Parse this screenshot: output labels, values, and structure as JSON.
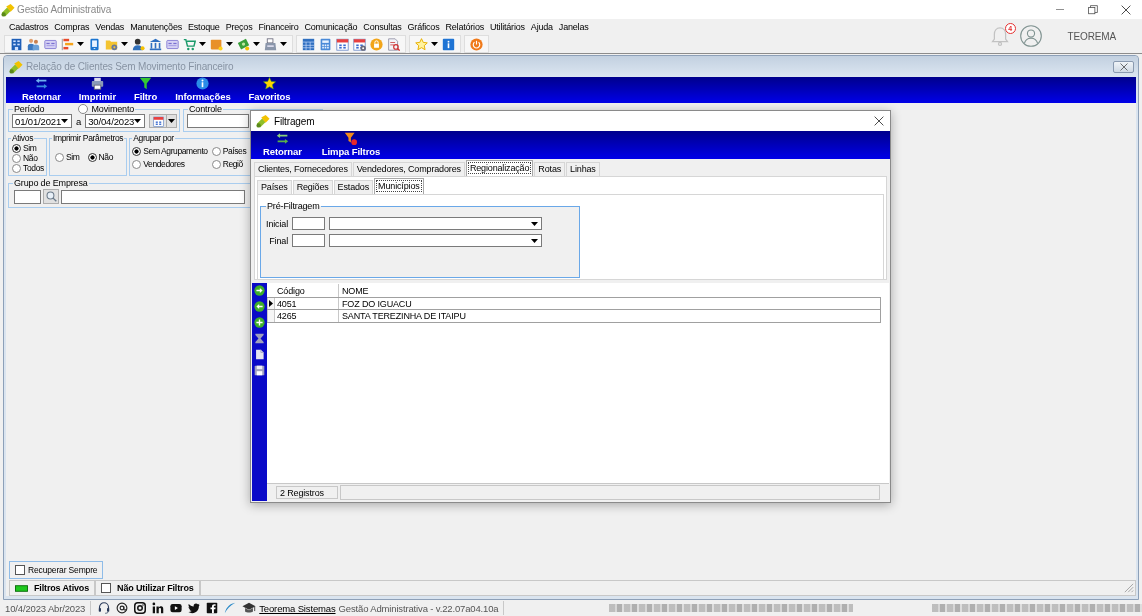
{
  "window": {
    "title": "Gestão Administrativa"
  },
  "menu": [
    "Cadastros",
    "Compras",
    "Vendas",
    "Manutenções",
    "Estoque",
    "Preços",
    "Financeiro",
    "Comunicação",
    "Consultas",
    "Gráficos",
    "Relatórios",
    "Utilitários",
    "Ajuda",
    "Janelas"
  ],
  "notifications": {
    "count": "4"
  },
  "user": {
    "name": "TEOREMA"
  },
  "report_window": {
    "title": "Relação de Clientes Sem Movimento Financeiro",
    "toolbar": [
      {
        "label": "Retornar"
      },
      {
        "label": "Imprimir"
      },
      {
        "label": "Filtro"
      },
      {
        "label": "Informações"
      },
      {
        "label": "Favoritos"
      }
    ],
    "period": {
      "legend": "Período",
      "movement": {
        "label": "Movimento",
        "selected": false
      },
      "start": "01/01/2021",
      "separator": "a",
      "end": "30/04/2023"
    },
    "control": {
      "legend": "Controle"
    },
    "ativos": {
      "legend": "Ativos",
      "options": [
        {
          "label": "Sim",
          "selected": true
        },
        {
          "label": "Não",
          "selected": false
        },
        {
          "label": "Todos",
          "selected": false
        }
      ]
    },
    "print_parameters": {
      "legend": "Imprimir Parâmetros",
      "options": [
        {
          "label": "Sim",
          "selected": false
        },
        {
          "label": "Não",
          "selected": true
        }
      ]
    },
    "group_by": {
      "legend": "Agrupar por",
      "options": [
        {
          "label": "Sem Agrupamento",
          "selected": true
        },
        {
          "label": "Países",
          "selected": false
        },
        {
          "label": "Vendedores",
          "selected": false
        },
        {
          "label": "Regiõ",
          "selected": false
        }
      ]
    },
    "company_group": {
      "legend": "Grupo de Empresa"
    },
    "recover_always": {
      "label": "Recuperar Sempre",
      "checked": false
    },
    "status": {
      "filters_active": {
        "label": "Filtros Ativos",
        "on": true
      },
      "no_filters": {
        "label": "Não Utilizar Filtros",
        "checked": false
      }
    }
  },
  "filter_dialog": {
    "title": "Filtragem",
    "toolbar": [
      {
        "label": "Retornar"
      },
      {
        "label": "Limpa Filtros"
      }
    ],
    "tabs": [
      {
        "label": "Clientes, Fornecedores",
        "selected": false
      },
      {
        "label": "Vendedores, Compradores",
        "selected": false
      },
      {
        "label": "Regionalização",
        "selected": true
      },
      {
        "label": "Rotas",
        "selected": false
      },
      {
        "label": "Linhas",
        "selected": false
      }
    ],
    "subtabs": [
      {
        "label": "Países",
        "selected": false
      },
      {
        "label": "Regiões",
        "selected": false
      },
      {
        "label": "Estados",
        "selected": false
      },
      {
        "label": "Municípios",
        "selected": true
      }
    ],
    "pre_filter": {
      "legend": "Pré-Filtragem",
      "fields": [
        {
          "label": "Inicial"
        },
        {
          "label": "Final"
        }
      ]
    },
    "table": {
      "columns": [
        "Código",
        "NOME"
      ],
      "rows": [
        {
          "cells": [
            "4051",
            "FOZ DO IGUACU"
          ],
          "selected": true
        },
        {
          "cells": [
            "4265",
            "SANTA TEREZINHA DE ITAIPU"
          ],
          "selected": false
        }
      ]
    },
    "record_count": "2 Registros"
  },
  "status_bar": {
    "date": "10/4/2023 Abr/2023",
    "link": "Teorema Sistemas",
    "version": "Gestão Administrativa - v.22.07a04.10a"
  }
}
